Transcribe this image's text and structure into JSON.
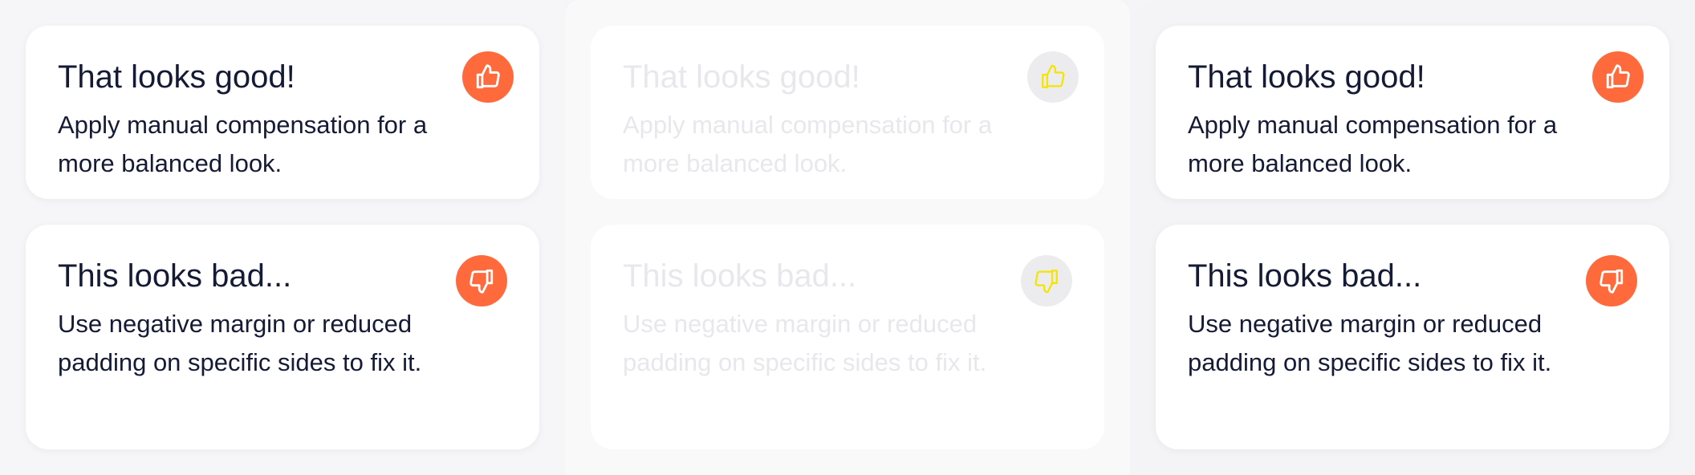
{
  "columns": [
    {
      "variant": "normal",
      "good": {
        "title": "That looks good!",
        "body": "Apply manual compensation for a more balanced look.",
        "icon": "thumbs-up-icon"
      },
      "bad": {
        "title": "This looks bad...",
        "body": "Use negative margin or reduced padding on specific sides to fix it.",
        "icon": "thumbs-down-icon"
      }
    },
    {
      "variant": "faded",
      "good": {
        "title": "That looks good!",
        "body": "Apply manual compensation for a more balanced look.",
        "icon": "thumbs-up-icon"
      },
      "bad": {
        "title": "This looks bad...",
        "body": "Use negative margin or reduced padding on specific sides to fix it.",
        "icon": "thumbs-down-icon"
      }
    },
    {
      "variant": "normal",
      "good": {
        "title": "That looks good!",
        "body": "Apply manual compensation for a more balanced look.",
        "icon": "thumbs-up-icon"
      },
      "bad": {
        "title": "This looks bad...",
        "body": "Use negative margin or reduced padding on specific sides to fix it.",
        "icon": "thumbs-down-icon"
      }
    }
  ],
  "colors": {
    "accent": "#ff6a3d",
    "text": "#151a35",
    "faded_text": "#e8e8ec",
    "faded_icon_stroke": "#f4e400"
  }
}
